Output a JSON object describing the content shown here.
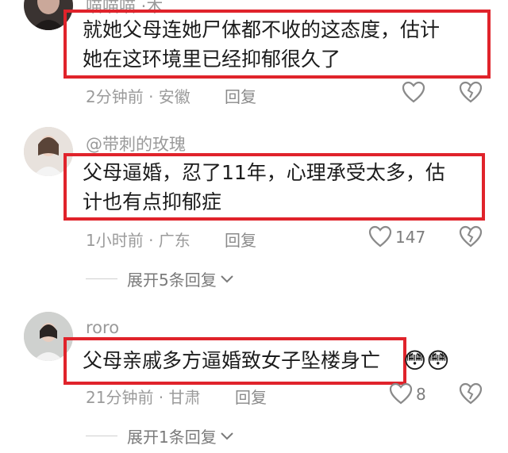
{
  "comments": [
    {
      "username": "喵喵喵 ·木",
      "text_line1": "就她父母连她尸体都不收的这态度，估计",
      "text_line2": "她在这环境里已经抑郁很久了",
      "meta": "2分钟前 · 安徽",
      "reply_label": "回复",
      "likes": ""
    },
    {
      "username": "@带刺的玫瑰",
      "text_line1": "父母逼婚，忍了11年，心理承受太多，估",
      "text_line2": "计也有点抑郁症",
      "meta": "1小时前 · 广东",
      "reply_label": "回复",
      "likes": "147",
      "expand_label": "展开5条回复"
    },
    {
      "username": "roro",
      "text_line1": "父母亲戚多方逼婚致女子坠楼身亡",
      "emoji": "😳😳",
      "meta": "21分钟前 · 甘肃",
      "reply_label": "回复",
      "likes": "8",
      "expand_label": "展开1条回复"
    }
  ],
  "icons": {
    "like": "heart-outline-icon",
    "dislike": "broken-heart-icon",
    "expand": "chevron-down-icon"
  },
  "colors": {
    "highlight_border": "#e0232b",
    "muted_text": "#9b9b9b"
  }
}
